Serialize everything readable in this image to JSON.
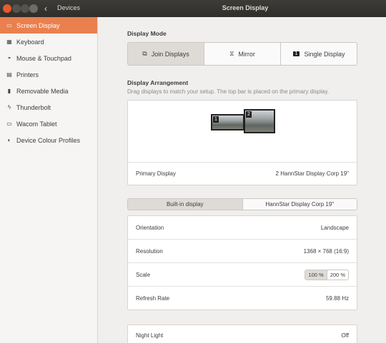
{
  "titlebar": {
    "back_glyph": "‹",
    "section": "Devices",
    "title": "Screen Display"
  },
  "sidebar": {
    "items": [
      {
        "label": "Screen Display",
        "icon": "display-icon",
        "glyph": "▭"
      },
      {
        "label": "Keyboard",
        "icon": "keyboard-icon",
        "glyph": "▦"
      },
      {
        "label": "Mouse & Touchpad",
        "icon": "mouse-icon",
        "glyph": "◓"
      },
      {
        "label": "Printers",
        "icon": "printer-icon",
        "glyph": "▤"
      },
      {
        "label": "Removable Media",
        "icon": "usb-icon",
        "glyph": "▮"
      },
      {
        "label": "Thunderbolt",
        "icon": "thunderbolt-icon",
        "glyph": "ϟ"
      },
      {
        "label": "Wacom Tablet",
        "icon": "tablet-icon",
        "glyph": "▭"
      },
      {
        "label": "Device Colour Profiles",
        "icon": "color-profile-icon",
        "glyph": "◐"
      }
    ]
  },
  "display_mode": {
    "heading": "Display Mode",
    "options": [
      {
        "label": "Join Displays",
        "icon": "join-displays-icon",
        "glyph": "⧉"
      },
      {
        "label": "Mirror",
        "icon": "mirror-icon",
        "glyph": "⧖"
      },
      {
        "label": "Single Display",
        "icon": "single-display-icon",
        "glyph": "1"
      }
    ]
  },
  "arrangement": {
    "heading": "Display Arrangement",
    "description": "Drag displays to match your setup. The top bar is placed on the primary display.",
    "monitor_labels": [
      "1",
      "2"
    ],
    "primary_label": "Primary Display",
    "primary_value": "2   HannStar Display Corp 19\""
  },
  "tabs": [
    "Built-in display",
    "HannStar Display Corp 19\""
  ],
  "settings": {
    "orientation_label": "Orientation",
    "orientation_value": "Landscape",
    "resolution_label": "Resolution",
    "resolution_value": "1368 × 768 (16:9)",
    "scale_label": "Scale",
    "scale_options": [
      "100 %",
      "200 %"
    ],
    "refresh_label": "Refresh Rate",
    "refresh_value": "59.88 Hz"
  },
  "night_light": {
    "label": "Night Light",
    "value": "Off"
  },
  "colors": {
    "accent": "#e9804e",
    "titlebar": "#3a3935",
    "close": "#e8592c"
  }
}
